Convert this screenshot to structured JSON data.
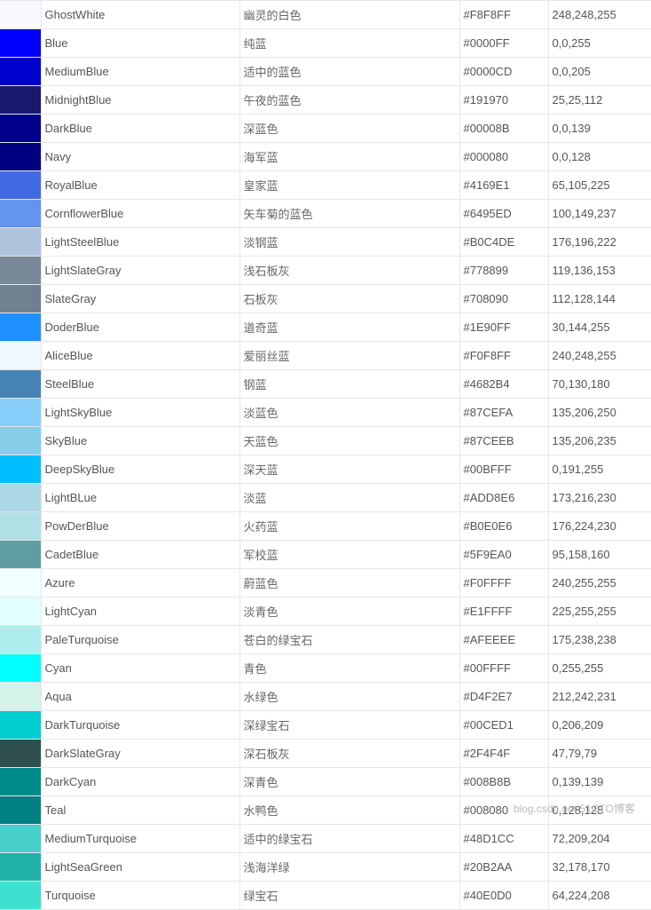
{
  "watermark": "blog.csdn.net 51CTO博客",
  "rows": [
    {
      "swatch": "#F8F8FF",
      "name": "GhostWhite",
      "zh": "幽灵的白色",
      "hex": "#F8F8FF",
      "rgb": "248,248,255"
    },
    {
      "swatch": "#0000FF",
      "name": "Blue",
      "zh": "纯蓝",
      "hex": "#0000FF",
      "rgb": "0,0,255"
    },
    {
      "swatch": "#0000CD",
      "name": "MediumBlue",
      "zh": "适中的蓝色",
      "hex": "#0000CD",
      "rgb": "0,0,205"
    },
    {
      "swatch": "#191970",
      "name": "MidnightBlue",
      "zh": "午夜的蓝色",
      "hex": "#191970",
      "rgb": "25,25,112"
    },
    {
      "swatch": "#00008B",
      "name": "DarkBlue",
      "zh": "深蓝色",
      "hex": "#00008B",
      "rgb": "0,0,139"
    },
    {
      "swatch": "#000080",
      "name": "Navy",
      "zh": "海军蓝",
      "hex": "#000080",
      "rgb": "0,0,128"
    },
    {
      "swatch": "#4169E1",
      "name": "RoyalBlue",
      "zh": "皇家蓝",
      "hex": "#4169E1",
      "rgb": "65,105,225"
    },
    {
      "swatch": "#6495ED",
      "name": "CornflowerBlue",
      "zh": "矢车菊的蓝色",
      "hex": "#6495ED",
      "rgb": "100,149,237"
    },
    {
      "swatch": "#B0C4DE",
      "name": "LightSteelBlue",
      "zh": "淡钢蓝",
      "hex": "#B0C4DE",
      "rgb": "176,196,222"
    },
    {
      "swatch": "#778899",
      "name": "LightSlateGray",
      "zh": "浅石板灰",
      "hex": "#778899",
      "rgb": "119,136,153"
    },
    {
      "swatch": "#708090",
      "name": "SlateGray",
      "zh": "石板灰",
      "hex": "#708090",
      "rgb": "112,128,144"
    },
    {
      "swatch": "#1E90FF",
      "name": "DoderBlue",
      "zh": "道奇蓝",
      "hex": "#1E90FF",
      "rgb": "30,144,255"
    },
    {
      "swatch": "#F0F8FF",
      "name": "AliceBlue",
      "zh": "爱丽丝蓝",
      "hex": "#F0F8FF",
      "rgb": "240,248,255"
    },
    {
      "swatch": "#4682B4",
      "name": "SteelBlue",
      "zh": "钢蓝",
      "hex": "#4682B4",
      "rgb": "70,130,180"
    },
    {
      "swatch": "#87CEFA",
      "name": "LightSkyBlue",
      "zh": "淡蓝色",
      "hex": "#87CEFA",
      "rgb": "135,206,250"
    },
    {
      "swatch": "#87CEEB",
      "name": "SkyBlue",
      "zh": "天蓝色",
      "hex": "#87CEEB",
      "rgb": "135,206,235"
    },
    {
      "swatch": "#00BFFF",
      "name": "DeepSkyBlue",
      "zh": "深天蓝",
      "hex": "#00BFFF",
      "rgb": "0,191,255"
    },
    {
      "swatch": "#ADD8E6",
      "name": "LightBLue",
      "zh": "淡蓝",
      "hex": "#ADD8E6",
      "rgb": "173,216,230"
    },
    {
      "swatch": "#B0E0E6",
      "name": "PowDerBlue",
      "zh": "火药蓝",
      "hex": "#B0E0E6",
      "rgb": "176,224,230"
    },
    {
      "swatch": "#5F9EA0",
      "name": "CadetBlue",
      "zh": "军校蓝",
      "hex": "#5F9EA0",
      "rgb": "95,158,160"
    },
    {
      "swatch": "#F0FFFF",
      "name": "Azure",
      "zh": "蔚蓝色",
      "hex": "#F0FFFF",
      "rgb": "240,255,255"
    },
    {
      "swatch": "#E1FFFF",
      "name": "LightCyan",
      "zh": "淡青色",
      "hex": "#E1FFFF",
      "rgb": "225,255,255"
    },
    {
      "swatch": "#AFEEEE",
      "name": "PaleTurquoise",
      "zh": "苍白的绿宝石",
      "hex": "#AFEEEE",
      "rgb": "175,238,238"
    },
    {
      "swatch": "#00FFFF",
      "name": "Cyan",
      "zh": "青色",
      "hex": "#00FFFF",
      "rgb": "0,255,255"
    },
    {
      "swatch": "#D4F2E7",
      "name": "Aqua",
      "zh": "水绿色",
      "hex": "#D4F2E7",
      "rgb": "212,242,231"
    },
    {
      "swatch": "#00CED1",
      "name": "DarkTurquoise",
      "zh": "深绿宝石",
      "hex": "#00CED1",
      "rgb": "0,206,209"
    },
    {
      "swatch": "#2F4F4F",
      "name": "DarkSlateGray",
      "zh": "深石板灰",
      "hex": "#2F4F4F",
      "rgb": "47,79,79"
    },
    {
      "swatch": "#008B8B",
      "name": "DarkCyan",
      "zh": "深青色",
      "hex": "#008B8B",
      "rgb": "0,139,139"
    },
    {
      "swatch": "#008080",
      "name": "Teal",
      "zh": "水鸭色",
      "hex": "#008080",
      "rgb": "0,128,128"
    },
    {
      "swatch": "#48D1CC",
      "name": "MediumTurquoise",
      "zh": "适中的绿宝石",
      "hex": "#48D1CC",
      "rgb": "72,209,204"
    },
    {
      "swatch": "#20B2AA",
      "name": "LightSeaGreen",
      "zh": "浅海洋绿",
      "hex": "#20B2AA",
      "rgb": "32,178,170"
    },
    {
      "swatch": "#40E0D0",
      "name": "Turquoise",
      "zh": "绿宝石",
      "hex": "#40E0D0",
      "rgb": "64,224,208"
    }
  ]
}
